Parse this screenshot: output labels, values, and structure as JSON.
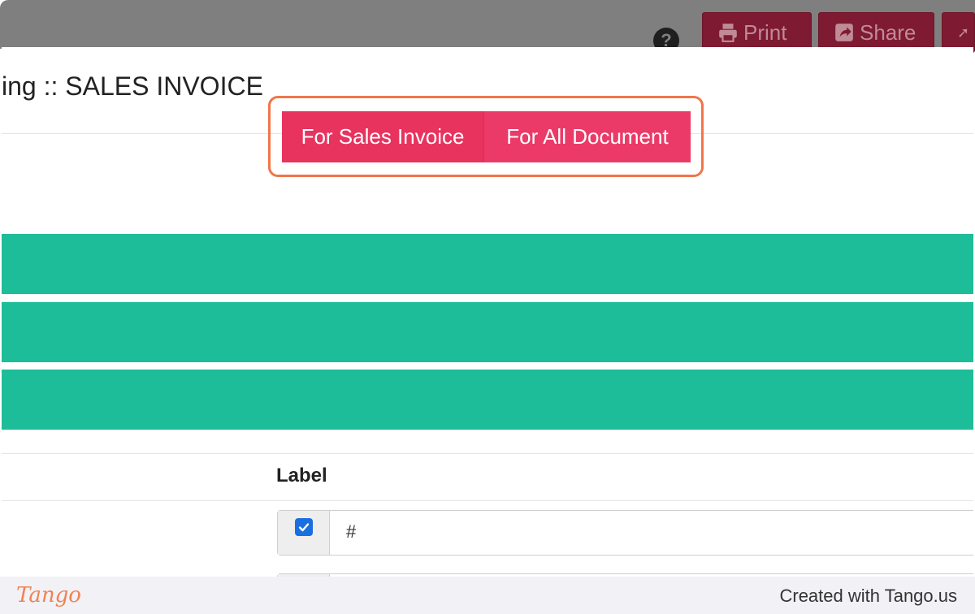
{
  "toolbar": {
    "help_icon": "question-circle-icon",
    "print_label": "Print",
    "print_icon": "printer-icon",
    "share_label": "Share",
    "share_icon": "share-icon",
    "more_icon": "expand-icon"
  },
  "page": {
    "title": "ing :: SALES INVOICE"
  },
  "segment": {
    "options": [
      "For Sales Invoice",
      "For All Document"
    ],
    "active_index": 0
  },
  "table": {
    "column_header": "Label",
    "rows": [
      {
        "checked": true,
        "value": "#"
      },
      {
        "checked": false,
        "value": ""
      }
    ]
  },
  "footer": {
    "logo": "Tango",
    "created_with": "Created with Tango.us"
  },
  "colors": {
    "topbar": "#7f7f7f",
    "accent_pink": "#ec3a68",
    "teal": "#1dbd99",
    "highlight_orange": "#f0764a"
  }
}
